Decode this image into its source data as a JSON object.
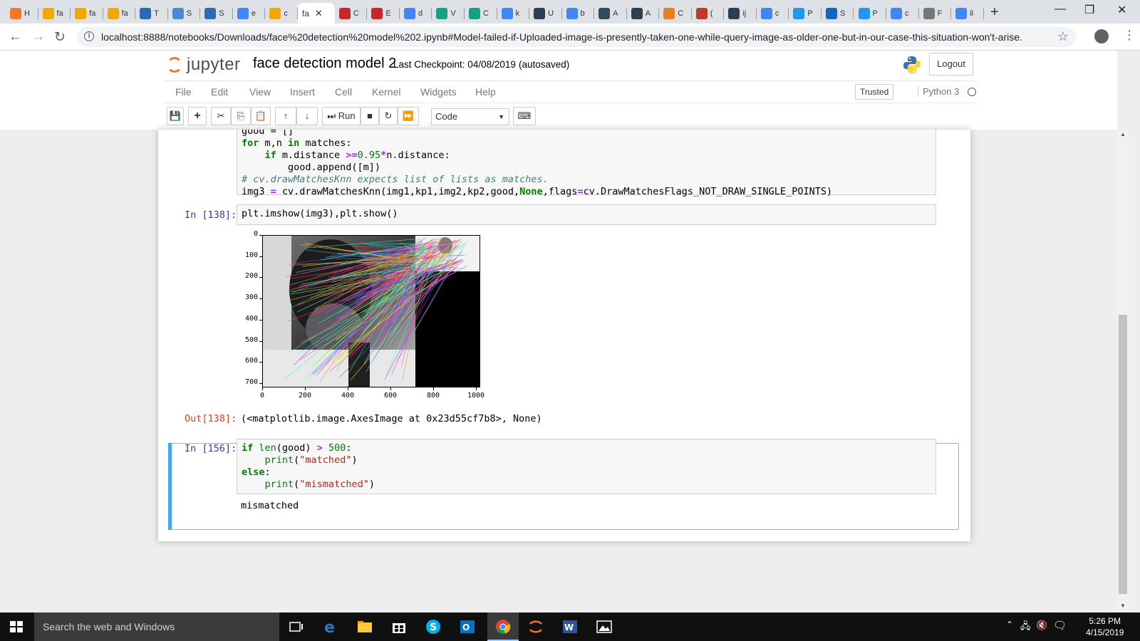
{
  "browser": {
    "tabs": [
      {
        "letter": "H",
        "color": "#f37726"
      },
      {
        "letter": "fa",
        "color": "#f4a700"
      },
      {
        "letter": "fa",
        "color": "#f4a700"
      },
      {
        "letter": "fa",
        "color": "#f4a700"
      },
      {
        "letter": "T",
        "color": "#2a6ab8"
      },
      {
        "letter": "S",
        "color": "#4a8ad4"
      },
      {
        "letter": "S",
        "color": "#2a6ab8"
      },
      {
        "letter": "e",
        "color": "#4285f4"
      },
      {
        "letter": "c",
        "color": "#f4a700"
      },
      {
        "letter": "C",
        "color": "#c62828"
      },
      {
        "letter": "E",
        "color": "#c62828"
      },
      {
        "letter": "d",
        "color": "#4285f4"
      },
      {
        "letter": "V",
        "color": "#16a085"
      },
      {
        "letter": "C",
        "color": "#16a085"
      },
      {
        "letter": "k",
        "color": "#4285f4"
      },
      {
        "letter": "U",
        "color": "#2c3e50"
      },
      {
        "letter": "b",
        "color": "#4285f4"
      },
      {
        "letter": "A",
        "color": "#34495e"
      },
      {
        "letter": "A",
        "color": "#2c3e50"
      },
      {
        "letter": "C",
        "color": "#e67e22"
      },
      {
        "letter": "(",
        "color": "#c0392b"
      },
      {
        "letter": "ij",
        "color": "#2c3e50"
      },
      {
        "letter": "c",
        "color": "#4285f4"
      },
      {
        "letter": "P",
        "color": "#2196f3"
      },
      {
        "letter": "S",
        "color": "#1565c0"
      },
      {
        "letter": "P",
        "color": "#2196f3"
      },
      {
        "letter": "c",
        "color": "#4285f4"
      },
      {
        "letter": "F",
        "color": "#777777"
      },
      {
        "letter": "il",
        "color": "#4285f4"
      }
    ],
    "active_tab": {
      "label": "fa",
      "close": "✕"
    },
    "new_tab": "+",
    "window_min": "—",
    "window_max": "❐",
    "window_close": "✕",
    "url": "localhost:8888/notebooks/Downloads/face%20detection%20model%202.ipynb#Model-failed-if-Uploaded-image-is-presently-taken-one-while-query-image-as-older-one-but-in-our-case-this-situation-won't-arise."
  },
  "jupyter": {
    "logo_text": "jupyter",
    "notebook_name": "face detection model 2",
    "checkpoint": "Last Checkpoint: 04/08/2019",
    "autosave": "(autosaved)",
    "logout": "Logout",
    "menu": [
      "File",
      "Edit",
      "View",
      "Insert",
      "Cell",
      "Kernel",
      "Widgets",
      "Help"
    ],
    "trusted": "Trusted",
    "kernel": "Python 3",
    "toolbar": {
      "run": "Run",
      "cell_type": "Code"
    }
  },
  "cells": {
    "cell1": {
      "lines": [
        "good = []",
        "for m,n in matches:",
        "    if m.distance >=0.95*n.distance:",
        "        good.append([m])",
        "# cv.drawMatchesKnn expects list of lists as matches.",
        "img3 = cv.drawMatchesKnn(img1,kp1,img2,kp2,good,None,flags=cv.DrawMatchesFlags_NOT_DRAW_SINGLE_POINTS)"
      ]
    },
    "cell2": {
      "prompt": "In [138]:",
      "code": "plt.imshow(img3),plt.show()"
    },
    "plot": {
      "y_ticks": [
        "0",
        "100",
        "200",
        "300",
        "400",
        "500",
        "600",
        "700"
      ],
      "x_ticks": [
        "0",
        "200",
        "400",
        "600",
        "800",
        "1000"
      ]
    },
    "out2": {
      "prompt": "Out[138]:",
      "text": "(<matplotlib.image.AxesImage at 0x23d55cf7b8>, None)"
    },
    "cell3": {
      "prompt": "In [156]:",
      "output": "mismatched"
    }
  },
  "taskbar": {
    "search": "Search the web and Windows",
    "time": "5:26 PM",
    "date": "4/15/2019"
  },
  "colors": {
    "accent": "#42a5f5",
    "jupyter_orange": "#f37726",
    "in_prompt": "#303f9f",
    "out_prompt": "#d84315"
  }
}
